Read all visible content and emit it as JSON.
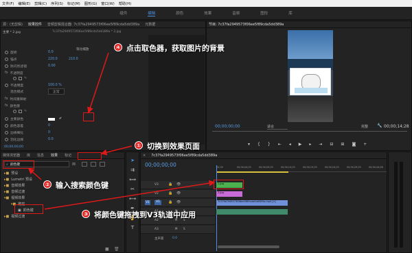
{
  "menu": [
    "文件(F)",
    "编辑(E)",
    "剪辑(C)",
    "序列(S)",
    "标记(M)",
    "图形(G)",
    "窗口(W)",
    "帮助(H)"
  ],
  "workspaces": [
    "组件",
    "编辑",
    "颜色",
    "效果",
    "音频",
    "图形",
    "库"
  ],
  "active_workspace": "编辑",
  "source_panel": {
    "tabs": [
      "源：(无剪辑)",
      "效果控件",
      "音频剪辑混合器: 7c37fa2949573f06ee5f89cda5dd389a",
      "元数据"
    ],
    "subtitle": "主要 * 2.jpg",
    "clip_ref": "7c37fa2949573f06ee5f89cda5dd389a * 2.jpg",
    "rows": [
      {
        "label": "旋转",
        "value": "0.0"
      },
      {
        "label": "锚点",
        "value": "220.0",
        "value2": "210.0"
      },
      {
        "label": "防闪烁滤镜",
        "value": "0.00"
      },
      {
        "label": "不透明度",
        "value": ""
      },
      {
        "label": "不透明度",
        "value": "100.0 %"
      },
      {
        "label": "混合模式",
        "value": "正常"
      },
      {
        "label": "时间重映射",
        "value": ""
      },
      {
        "label": "颜色键",
        "value": ""
      },
      {
        "label": "主要颜色",
        "value": ""
      },
      {
        "label": "颜色容差",
        "value": "0"
      },
      {
        "label": "边缘细化",
        "value": "0"
      },
      {
        "label": "羽化边缘",
        "value": "0.0"
      }
    ],
    "uniform_scale": "等比缩放",
    "timecode": "00;00;00;00"
  },
  "program_panel": {
    "title": "节目: 7c37fa2949573f06ee5f89cda5dd389a",
    "timecode": "00;00;00;00",
    "fit": "适合",
    "quality": "完整",
    "duration": "00;00;14;28"
  },
  "project_panel": {
    "tabs": [
      "媒体浏览器",
      "库",
      "信息",
      "效果",
      "标记"
    ],
    "search_value": "颜色键",
    "items": [
      "预设",
      "Lumetri 预设",
      "音频效果",
      "音频过渡",
      "视频效果",
      "键控",
      "颜色键",
      "视频过渡"
    ]
  },
  "timeline": {
    "title": "7c37fa2949573f06ee5f89cda5dd389a",
    "timecode": "00;00;00;00",
    "ruler": [
      "00;00",
      "00;00;04;29",
      "00;00;09;29",
      "00;00;14;29",
      "00;00;19;29",
      "00;00;24;29",
      "00;00;29;29",
      "00;00;34;28"
    ],
    "tracks": [
      "V3",
      "V2",
      "V1",
      "A1",
      "A2",
      "A3"
    ],
    "master": "主声道",
    "master_value": "0.0",
    "clips": {
      "v3": "2.jpg",
      "v2": "2.jpg",
      "v1": "7c37fa2949573f06ee5f89cda5dd389a.mp4 [V]"
    }
  },
  "annotations": [
    {
      "num": "①",
      "text": "切换到效果页面"
    },
    {
      "num": "②",
      "text": "输入搜索颜色键"
    },
    {
      "num": "③",
      "text": "将颜色键拖拽到V3轨道中应用"
    },
    {
      "num": "④",
      "text": "点击取色器，获取图片的背景"
    }
  ],
  "colors": {
    "annotation": "#e01919",
    "accent": "#4a90e2",
    "clip_v3": "#4caf50",
    "clip_v2": "#c86ad8",
    "clip_v1": "#6f8fd8"
  }
}
